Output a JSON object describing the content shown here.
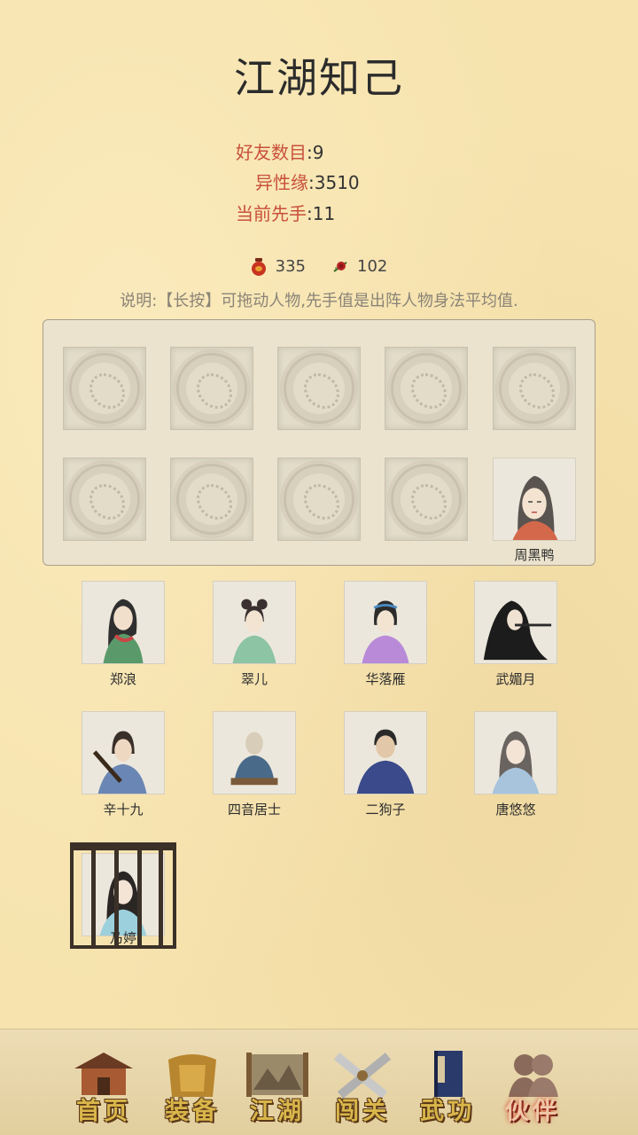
{
  "page": {
    "title": "江湖知己"
  },
  "stats": [
    {
      "label": "好友数目",
      "value": ":9"
    },
    {
      "label": "异性缘",
      "value": ":3510"
    },
    {
      "label": "当前先手",
      "value": ":11"
    }
  ],
  "currency": {
    "jar_value": "335",
    "rose_value": "102",
    "jar_icon": "wine-jar-icon",
    "rose_icon": "rose-icon"
  },
  "note": "说明:【长按】可拖动人物,先手值是出阵人物身法平均值.",
  "formation": {
    "filled_slot_name": "周黑鸭"
  },
  "roster": [
    {
      "name": "郑浪"
    },
    {
      "name": "翠儿"
    },
    {
      "name": "华落雁"
    },
    {
      "name": "武媚月"
    },
    {
      "name": "辛十九"
    },
    {
      "name": "四音居士"
    },
    {
      "name": "二狗子"
    },
    {
      "name": "唐悠悠"
    },
    {
      "name": "乃婷"
    }
  ],
  "nav": [
    {
      "label": "首页",
      "icon": "pavilion-icon"
    },
    {
      "label": "装备",
      "icon": "armor-icon"
    },
    {
      "label": "江湖",
      "icon": "scroll-map-icon"
    },
    {
      "label": "闯关",
      "icon": "crossed-swords-icon"
    },
    {
      "label": "武功",
      "icon": "martial-book-icon"
    },
    {
      "label": "伙伴",
      "icon": "companions-icon"
    }
  ],
  "colors": {
    "background": "#f6e3ae",
    "label_red": "#c8503a",
    "nav_gold": "#d9b64a"
  }
}
